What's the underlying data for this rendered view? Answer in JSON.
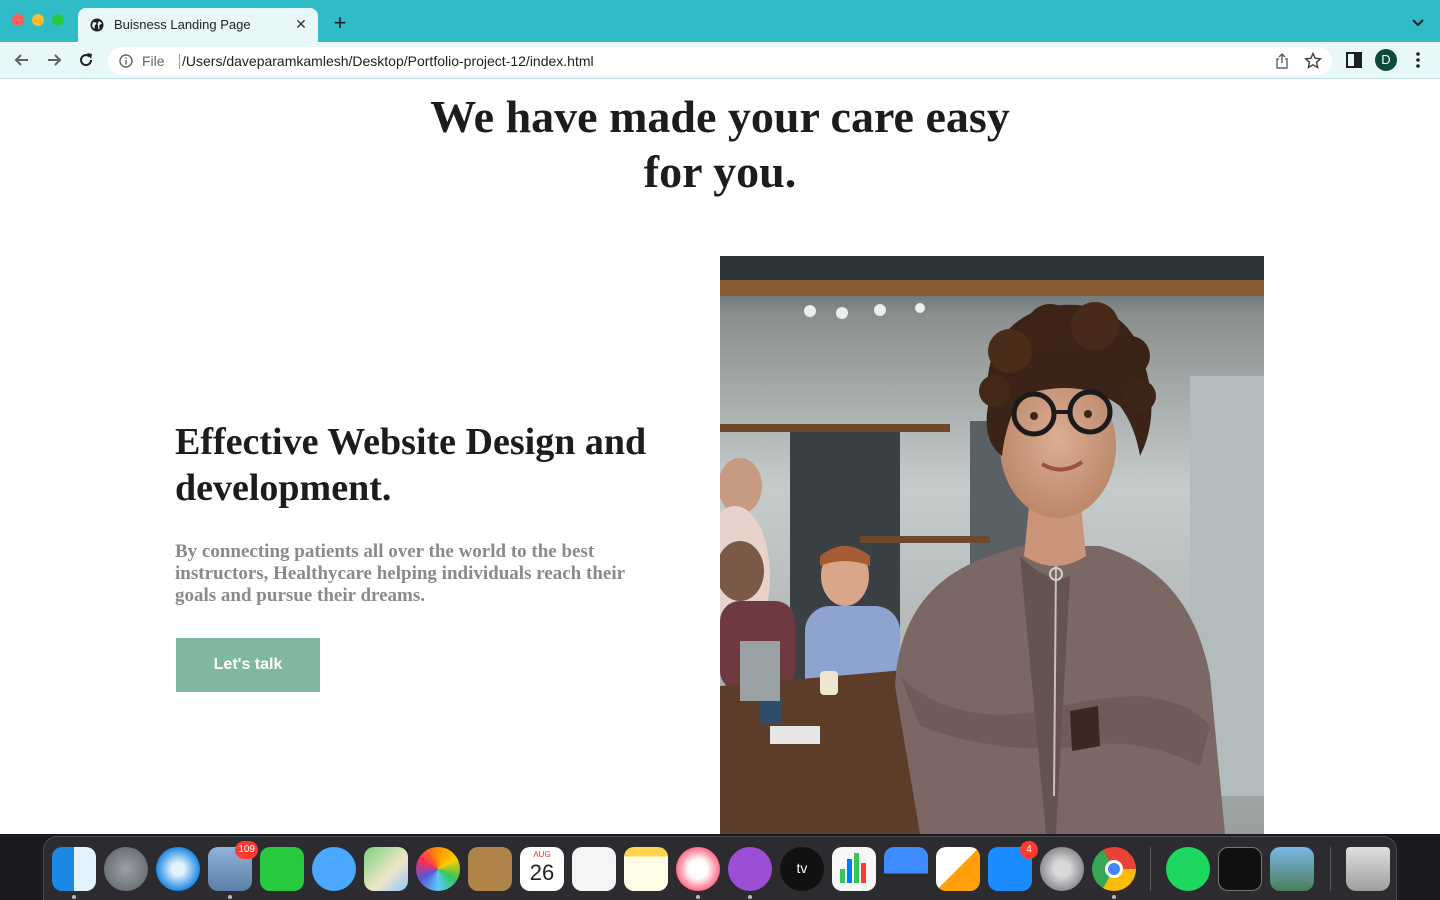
{
  "browser": {
    "tab_title": "Buisness Landing Page",
    "tab_close": "✕",
    "new_tab": "+",
    "file_label": "File",
    "url": "/Users/daveparamkamlesh/Desktop/Portfolio-project-12/index.html",
    "profile_initial": "D"
  },
  "colors": {
    "titlebar": "#30bcc6",
    "toolbar": "#e8f8f9",
    "cta_button": "#7fb89e",
    "heading_text": "#1c1c1c",
    "body_text": "#8a8a8a"
  },
  "page": {
    "hero_title": "We have made your care easy for you.",
    "feature_title": "Effective Website Design and development.",
    "feature_text": "By connecting patients all over the world to the best instructors, Healthycare helping individuals reach their goals and pursue their dreams.",
    "cta_label": "Let's talk"
  },
  "dock": {
    "mail_badge": "109",
    "calendar_month": "AUG",
    "calendar_day": "26",
    "tv_label": "tv",
    "appstore_badge": "4"
  }
}
